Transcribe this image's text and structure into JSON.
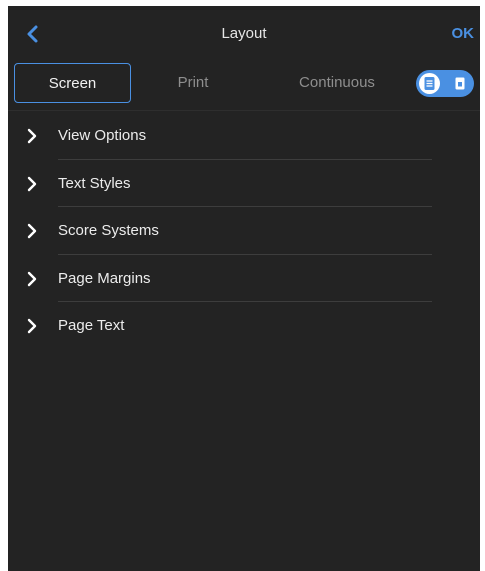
{
  "header": {
    "title": "Layout",
    "ok_label": "OK",
    "back_icon": "chevron-left-icon"
  },
  "tabs": [
    {
      "label": "Screen",
      "active": true
    },
    {
      "label": "Print",
      "active": false
    },
    {
      "label": "Continuous",
      "active": false
    }
  ],
  "view_toggle": {
    "left_icon": "document-list-icon",
    "right_icon": "document-icon",
    "state": "left"
  },
  "sections": [
    {
      "label": "View Options"
    },
    {
      "label": "Text Styles"
    },
    {
      "label": "Score Systems"
    },
    {
      "label": "Page Margins"
    },
    {
      "label": "Page Text"
    }
  ],
  "colors": {
    "panel_bg": "#232323",
    "accent": "#4a90e2",
    "text": "#ececec",
    "muted": "#8e8e8e",
    "separator": "#3d3d3d"
  }
}
